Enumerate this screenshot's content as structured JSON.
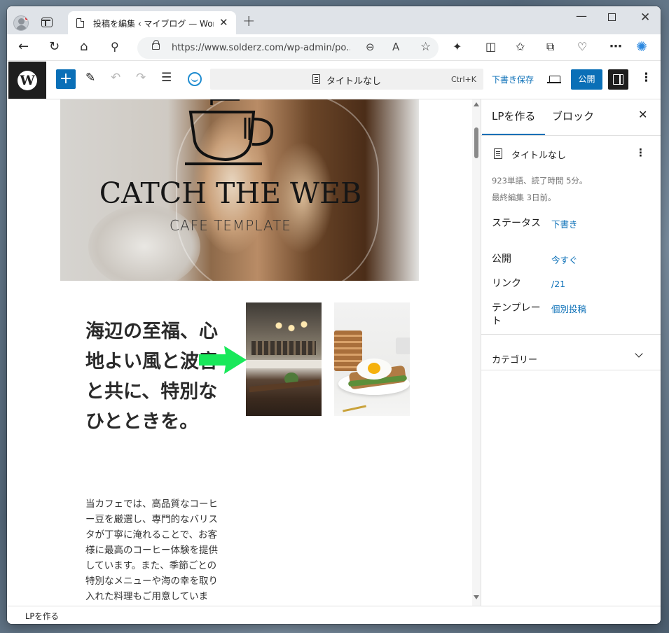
{
  "browser": {
    "tab_title": "投稿を編集 ‹ マイブログ — WordPress",
    "new_tab": "+",
    "url": "https://www.solderz.com/wp-admin/po...",
    "minimize": "—",
    "close": "✕",
    "tab_close": "✕"
  },
  "wp_toolbar": {
    "wp_logo": "W",
    "add": "+",
    "command_title": "タイトルなし",
    "command_shortcut": "Ctrl+K",
    "save_draft": "下書き保存",
    "publish": "公開",
    "more": "⋮"
  },
  "content": {
    "hero_title": "CATCH THE WEB",
    "hero_subtitle": "CAFE TEMPLATE",
    "headline": "海辺の至福、心地よい風と波音と共に、特別なひとときを。",
    "body": "当カフェでは、高品質なコーヒー豆を厳選し、専門的なバリスタが丁寧に淹れることで、お客様に最高のコーヒー体験を提供しています。また、季節ごとの特別なメニューや海の幸を取り入れた料理もご用意しています。"
  },
  "sidebar": {
    "tab_lp": "LPを作る",
    "tab_block": "ブロック",
    "close": "✕",
    "post_title": "タイトルなし",
    "post_more": "⋮",
    "word_count": "923単語、読了時間 5分。",
    "last_edited": "最終編集 3日前。",
    "status_label": "ステータス",
    "status_value": "下書き",
    "publish_label": "公開",
    "publish_value": "今すぐ",
    "link_label": "リンク",
    "link_value": "/21",
    "template_label": "テンプレート",
    "template_value": "個別投稿",
    "category_label": "カテゴリー"
  },
  "footer": {
    "breadcrumb": "LPを作る"
  },
  "colors": {
    "accent": "#0a6fb7",
    "toolbar_dark": "#1e1e1e",
    "annotation_arrow": "#19e85a"
  }
}
